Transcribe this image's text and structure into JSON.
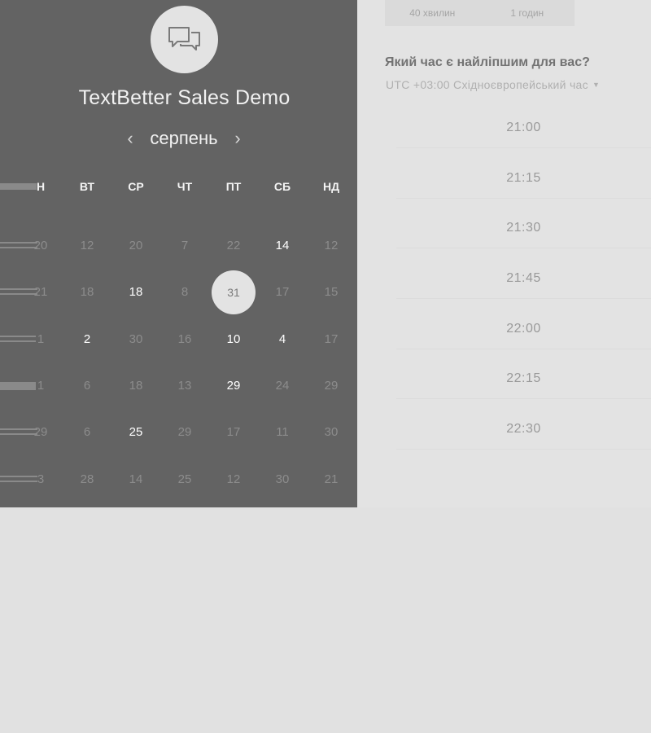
{
  "app": {
    "title": "TextBetter Sales Demo",
    "logo_icon": "chat-bubbles-icon"
  },
  "calendar": {
    "month": "серпень",
    "prev_icon": "chevron-left-icon",
    "next_icon": "chevron-right-icon",
    "weekdays": [
      "Н",
      "ВТ",
      "СР",
      "ЧТ",
      "ПТ",
      "СБ",
      "НД"
    ],
    "rows": [
      [
        "20",
        "12",
        "20",
        "7",
        "22",
        "14",
        "12"
      ],
      [
        "21",
        "18",
        "18",
        "8",
        "31",
        "17",
        "15"
      ],
      [
        "1",
        "2",
        "30",
        "16",
        "10",
        "4",
        "17"
      ],
      [
        "1",
        "6",
        "18",
        "13",
        "29",
        "24",
        "29"
      ],
      [
        "29",
        "6",
        "25",
        "29",
        "17",
        "11",
        "30"
      ],
      [
        "3",
        "28",
        "14",
        "25",
        "12",
        "30",
        "21"
      ]
    ],
    "available": [
      [
        0,
        5
      ],
      [
        1,
        2
      ],
      [
        2,
        1
      ],
      [
        2,
        4
      ],
      [
        2,
        5
      ],
      [
        3,
        4
      ],
      [
        4,
        2
      ]
    ],
    "selected": [
      1,
      4
    ]
  },
  "durations": [
    "40 хвилин",
    "1 годин"
  ],
  "scheduler": {
    "question": "Який час є найліпшим для вас?",
    "timezone": "UTC +03:00 Східноєвропейський час",
    "timezone_caret": "caret-down-icon",
    "slots": [
      "21:00",
      "21:15",
      "21:30",
      "21:45",
      "22:00",
      "22:15",
      "22:30"
    ]
  },
  "colors": {
    "panel": "#636363",
    "background": "#e1e1e1",
    "available_day": "#ffffff",
    "muted_day": "#8c8c8c"
  }
}
